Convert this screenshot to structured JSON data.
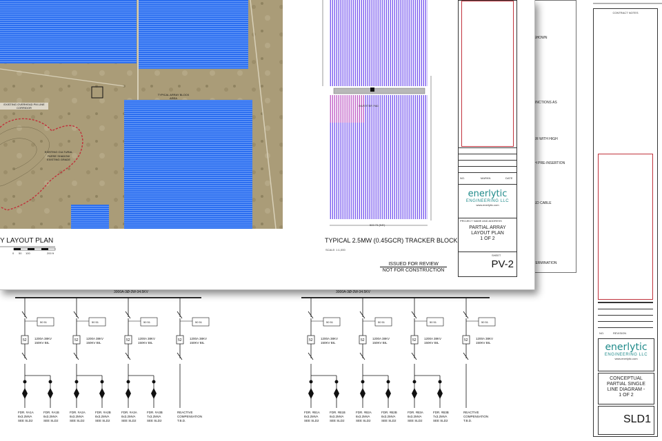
{
  "back_sheet": {
    "notes": [
      "CE SHOWN",
      "E FUNCTIONS AS",
      "RMER WITH HIGH",
      "WITH PRE-INSERTION",
      "LATED CABLE",
      "LE TERMINATION"
    ],
    "bus_left_label": "3000A-3Ø-3W-34.5KV",
    "bus_right_label": "3000A-3Ø-3W-34.5KV",
    "left_breakers": [
      {
        "id": "52",
        "rating": "1200A 38KV\n150KV BIL",
        "ct": "50 51",
        "feeders": [
          {
            "name": "FDR. #A1A",
            "size": "8x3.2MVA",
            "ref": "SEE SLD2"
          },
          {
            "name": "FDR. #A1B",
            "size": "8x3.2MVA",
            "ref": "SEE SLD2"
          }
        ]
      },
      {
        "id": "52",
        "rating": "1200A 38KV\n150KV BIL",
        "ct": "50 51",
        "feeders": [
          {
            "name": "FDR. #A2A",
            "size": "8x3.2MVA",
            "ref": "SEE SLD2"
          },
          {
            "name": "FDR. #A2B",
            "size": "8x3.2MVA",
            "ref": "SEE SLD2"
          }
        ]
      },
      {
        "id": "52",
        "rating": "1200A 38KV\n150KV BIL",
        "ct": "50 51",
        "feeders": [
          {
            "name": "FDR. #A3A",
            "size": "8x3.2MVA",
            "ref": "SEE SLD2"
          },
          {
            "name": "FDR. #A3B",
            "size": "7x3.2MVA",
            "ref": "SEE SLD2"
          }
        ]
      },
      {
        "id": "52",
        "rating": "1200A 38KV\n150KV BIL",
        "ct": "50 51",
        "feeders": [
          {
            "name": "REACTIVE",
            "size": "COMPENSATION",
            "ref": "T.B.D."
          }
        ]
      }
    ],
    "right_breakers": [
      {
        "id": "52",
        "rating": "1200A 38KV\n150KV BIL",
        "ct": "50 51",
        "feeders": [
          {
            "name": "FDR. #B1A",
            "size": "8x3.2MVA",
            "ref": "SEE SLD2"
          },
          {
            "name": "FDR. #B1B",
            "size": "8x3.2MVA",
            "ref": "SEE SLD2"
          }
        ]
      },
      {
        "id": "52",
        "rating": "1200A 38KV\n150KV BIL",
        "ct": "50 51",
        "feeders": [
          {
            "name": "FDR. #B2A",
            "size": "8x3.2MVA",
            "ref": "SEE SLD2"
          },
          {
            "name": "FDR. #B2B",
            "size": "8x3.2MVA",
            "ref": "SEE SLD2"
          }
        ]
      },
      {
        "id": "52",
        "rating": "1200A 38KV\n150KV BIL",
        "ct": "50 51",
        "feeders": [
          {
            "name": "FDR. #B3A",
            "size": "8x3.2MVA",
            "ref": "SEE SLD2"
          },
          {
            "name": "FDR. #B3B",
            "size": "7x3.2MVA",
            "ref": "SEE SLD2"
          }
        ]
      },
      {
        "id": "52",
        "rating": "1200A 38KV\n150KV BIL",
        "ct": "50 51",
        "feeders": [
          {
            "name": "REACTIVE",
            "size": "COMPENSATION",
            "ref": "T.B.D."
          }
        ]
      }
    ],
    "title_block": {
      "header": "CONTRACT NOTES",
      "logo_main": "enerlytic",
      "logo_sub": "ENGINEERING LLC",
      "logo_url": "www.enerlytic.com",
      "title_lines": [
        "CONCEPTUAL",
        "PARTIAL SINGLE",
        "LINE DIAGRAM -",
        "1 OF 2"
      ],
      "sheet_no": "SLD1",
      "rev_label": "REVISION",
      "rev_no": "NO."
    }
  },
  "front_sheet": {
    "layout_title": "Y LAYOUT PLAN",
    "scale_bar_labels": [
      "0",
      "50",
      "100",
      "200 ft"
    ],
    "map_labels": [
      "EXISTING OVERHEAD PM LINE CORRIDOR",
      "TYPICAL ARRAY BLOCK AREA",
      "WETLAND / ARROYO",
      "EXISTING CULTURAL",
      "PARSE SHADOW EXISTING GRADE"
    ],
    "tracker_title": "TYPICAL 2.5MW (0.45GCR) TRACKER BLOCK",
    "tracker_scale": "SCALE: 1:1,000",
    "tracker_dim_bottom": "522.73 (NS')",
    "tracker_dim_left": "1345.08",
    "tracker_label": "INVERTER PAD",
    "review_line1": "ISSUED FOR REVIEW",
    "review_line2": "NOT FOR CONSTRUCTION",
    "title_block": {
      "no_label": "NO.",
      "rev_name": "MARKN",
      "rev_date": "DATE",
      "logo_main": "enerlytic",
      "logo_sub": "ENGINEERING LLC",
      "logo_url": "www.enerlytic.com",
      "title_lines": [
        "PARTIAL ARRAY",
        "LAYOUT PLAN",
        "1 OF 2"
      ],
      "sheet_no": "PV-2",
      "project_label": "PROJECT NAME AND ADDRESS",
      "sheet_label": "SHEET"
    }
  },
  "colors": {
    "array_blue": "#2b6ef0",
    "tracker_purple": "#7b5cf0",
    "tracker_pink": "#c060c8",
    "ground": "#a89a76",
    "logo_teal": "#1f8a8a",
    "border_red": "#c0303a"
  }
}
